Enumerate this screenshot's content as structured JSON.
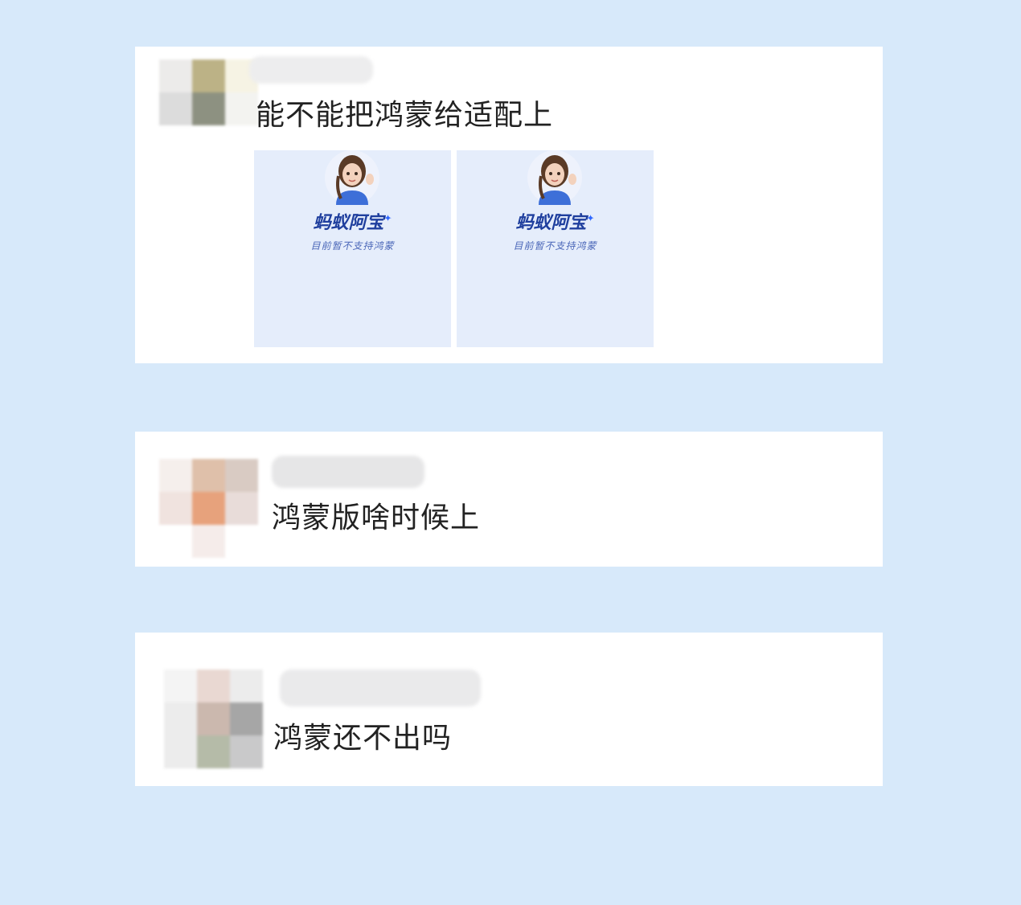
{
  "comments": [
    {
      "text": "能不能把鸿蒙给适配上",
      "attachments": [
        {
          "brand": "蚂蚁阿宝",
          "note": "目前暂不支持鸿蒙"
        },
        {
          "brand": "蚂蚁阿宝",
          "note": "目前暂不支持鸿蒙"
        }
      ]
    },
    {
      "text": "鸿蒙版啥时候上"
    },
    {
      "text": "鸿蒙还不出吗"
    }
  ],
  "colors": {
    "background": "#d7e9fa",
    "card": "#ffffff",
    "brand_text": "#1f3f9e",
    "thumbnail_bg": "#e5edfb"
  },
  "icons": [
    "avatar-mosaic",
    "username-blur",
    "cartoon-girl-avatar-icon",
    "sparkle-icon"
  ]
}
